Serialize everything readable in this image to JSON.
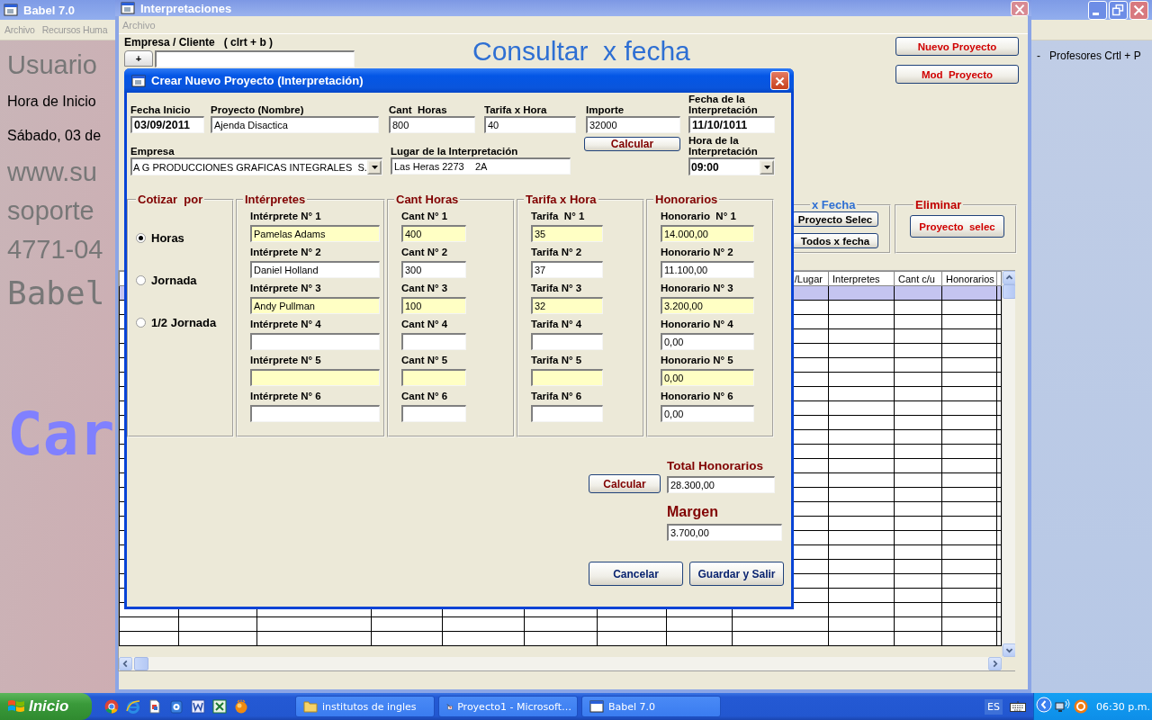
{
  "babel_window": {
    "title": "Babel 7.0",
    "menu": [
      "Archivo",
      "Recursos Huma"
    ],
    "panel_texts": [
      {
        "text": "Usuario",
        "kind": "large"
      },
      {
        "text": "Hora de Inicio",
        "kind": "info"
      },
      {
        "text": "Sábado, 03 de",
        "kind": "info"
      },
      {
        "text": "www.su",
        "kind": "large"
      },
      {
        "text": "soporte",
        "kind": "large"
      },
      {
        "text": "4771-04",
        "kind": "large"
      },
      {
        "text": "Babel",
        "kind": "brand"
      },
      {
        "text": "Car",
        "kind": "banner"
      }
    ],
    "side_items": [
      {
        "bullet": "-",
        "text": "Profesores Crtl + P"
      }
    ]
  },
  "interpretaciones_window": {
    "title": "Interpretaciones",
    "menu": [
      "Archivo"
    ],
    "client_label": "Empresa / Cliente   ( clrt + b )",
    "add_button": "+",
    "heading": "Consultar  x fecha",
    "buttons": [
      "Nuevo Proyecto",
      "Mod  Proyecto"
    ],
    "frames": [
      {
        "title": "x Fecha",
        "kind": "list",
        "buttons": [
          "Proyecto Selec",
          "Todos x fecha"
        ]
      },
      {
        "title": "Eliminar",
        "kind": "action",
        "buttons": [
          "Proyecto  selec"
        ]
      }
    ],
    "table": {
      "columns": [
        "/Lugar",
        "Interpretes",
        "Cant c/u",
        "Honorarios"
      ],
      "rows": [
        {
          "selected": true
        },
        {
          "selected": false
        },
        {
          "selected": false
        },
        {
          "selected": false
        },
        {
          "selected": false
        },
        {
          "selected": false
        },
        {
          "selected": false
        },
        {
          "selected": false
        },
        {
          "selected": false
        },
        {
          "selected": false
        },
        {
          "selected": false
        },
        {
          "selected": false
        },
        {
          "selected": false
        },
        {
          "selected": false
        },
        {
          "selected": false
        },
        {
          "selected": false
        },
        {
          "selected": false
        },
        {
          "selected": false
        },
        {
          "selected": false
        },
        {
          "selected": false
        },
        {
          "selected": false
        },
        {
          "selected": false
        },
        {
          "selected": false
        },
        {
          "selected": false
        },
        {
          "selected": false
        }
      ]
    }
  },
  "dialog": {
    "title": "Crear Nuevo Proyecto (Interpretación)",
    "start_date": {
      "label": "Fecha Inicio",
      "value": "03/09/2011"
    },
    "project": {
      "label": "Proyecto (Nombre)",
      "value": "Ajenda Disactica"
    },
    "hours": {
      "label": "Cant  Horas",
      "value": "800"
    },
    "rate": {
      "label": "Tarifa x Hora",
      "value": "40"
    },
    "amount": {
      "label": "Importe",
      "value": "32000"
    },
    "interp_date": {
      "label": "Fecha de la Interpretación",
      "value": "11/10/1011"
    },
    "company": {
      "label": "Empresa",
      "value": "A G PRODUCCIONES GRAFICAS INTEGRALES  S."
    },
    "place": {
      "label": "Lugar de la Interpretación",
      "value": "Las Heras 2273    2A"
    },
    "calc_button": "Calcular",
    "interp_time": {
      "label": "Hora de la Interpretación",
      "value": "09:00"
    },
    "quote_by": {
      "title": "Cotizar  por",
      "options": [
        {
          "label": "Horas",
          "selected": true
        },
        {
          "label": "Jornada",
          "selected": false
        },
        {
          "label": "1/2 Jornada",
          "selected": false
        }
      ]
    },
    "groups": [
      {
        "title": "Intérpretes",
        "kind": "name",
        "entries": [
          {
            "label": "Intérprete N° 1",
            "value": "Pamelas Adams",
            "highlighted": true
          },
          {
            "label": "Intérprete N° 2",
            "value": "Daniel Holland",
            "highlighted": false
          },
          {
            "label": "Intérprete N° 3",
            "value": "Andy Pullman",
            "highlighted": true
          },
          {
            "label": "Intérprete N° 4",
            "highlighted": false
          },
          {
            "label": "Intérprete N° 5",
            "highlighted": true
          },
          {
            "label": "Intérprete N° 6",
            "highlighted": false
          }
        ]
      },
      {
        "title": "Cant Horas",
        "kind": "hours",
        "entries": [
          {
            "label": "Cant N° 1",
            "value": "400",
            "highlighted": true
          },
          {
            "label": "Cant N° 2",
            "value": "300",
            "highlighted": false
          },
          {
            "label": "Cant N° 3",
            "value": "100",
            "highlighted": true
          },
          {
            "label": "Cant N° 4",
            "highlighted": false
          },
          {
            "label": "Cant N° 5",
            "highlighted": true
          },
          {
            "label": "Cant N° 6",
            "highlighted": false
          }
        ]
      },
      {
        "title": "Tarifa x Hora",
        "kind": "rate",
        "entries": [
          {
            "label": "Tarifa  N° 1",
            "value": "35",
            "highlighted": true
          },
          {
            "label": "Tarifa N° 2",
            "value": "37",
            "highlighted": false
          },
          {
            "label": "Tarifa N° 3",
            "value": "32",
            "highlighted": true
          },
          {
            "label": "Tarifa N° 4",
            "highlighted": false
          },
          {
            "label": "Tarifa N° 5",
            "highlighted": true
          },
          {
            "label": "Tarifa N° 6",
            "highlighted": false
          }
        ]
      },
      {
        "title": "Honorarios",
        "kind": "fee",
        "entries": [
          {
            "label": "Honorario  N° 1",
            "value": "14.000,00",
            "highlighted": true
          },
          {
            "label": "Honorario N° 2",
            "value": "11.100,00",
            "highlighted": false
          },
          {
            "label": "Honorario N° 3",
            "value": "3.200,00",
            "highlighted": true
          },
          {
            "label": "Honorario N° 4",
            "value": "0,00",
            "highlighted": false
          },
          {
            "label": "Honorario N° 5",
            "value": "0,00",
            "highlighted": true
          },
          {
            "label": "Honorario N° 6",
            "value": "0,00",
            "highlighted": false
          }
        ]
      }
    ],
    "calc_total_button": "Calcular",
    "total": {
      "label": "Total Honorarios",
      "value": "28.300,00"
    },
    "margin": {
      "label": "Margen",
      "value": "3.700,00"
    },
    "actions": [
      "Cancelar",
      "Guardar y Salir"
    ]
  },
  "taskbar": {
    "start": "Inicio",
    "tasks": [
      {
        "label": "institutos de ingles",
        "kind": "folder"
      },
      {
        "label": "Proyecto1 - Microsoft…",
        "kind": "project"
      },
      {
        "label": "Babel 7.0",
        "kind": "app"
      }
    ],
    "language": "ES",
    "clock": "06:30 p.m."
  }
}
